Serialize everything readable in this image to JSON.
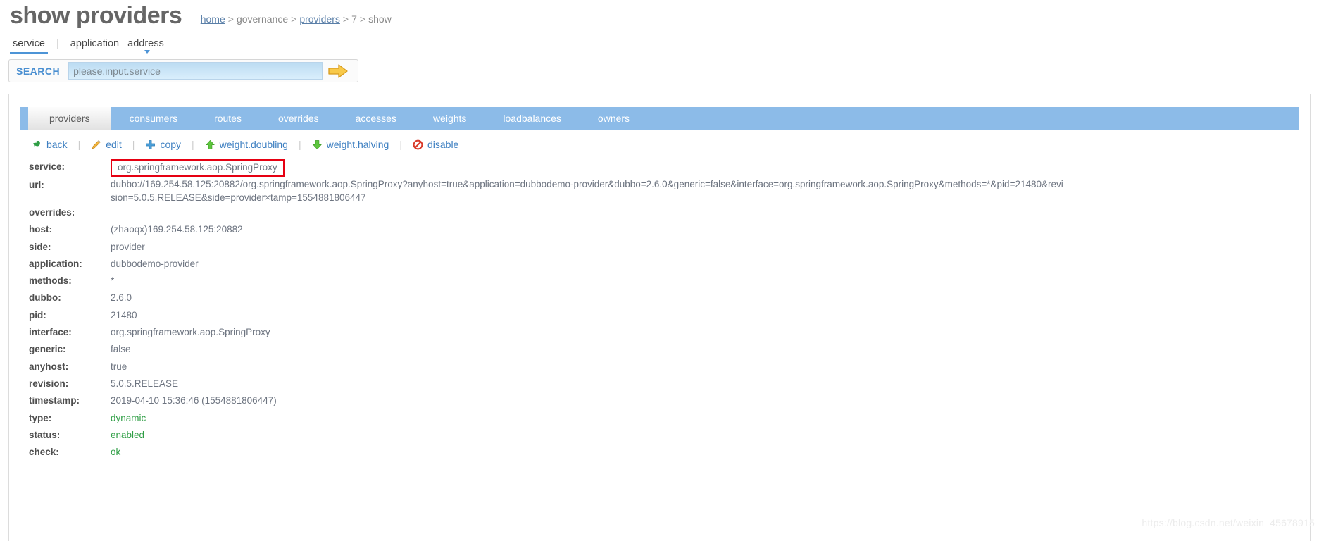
{
  "header": {
    "title": "show providers",
    "breadcrumb": [
      {
        "text": "home",
        "link": true
      },
      {
        "text": ">",
        "sep": true
      },
      {
        "text": "governance",
        "link": false
      },
      {
        "text": ">",
        "sep": true
      },
      {
        "text": "providers",
        "link": true
      },
      {
        "text": ">",
        "sep": true
      },
      {
        "text": "7",
        "link": false
      },
      {
        "text": ">",
        "sep": true
      },
      {
        "text": "show",
        "link": false
      }
    ],
    "breadcrumb_items": {
      "home": "home",
      "governance": "governance",
      "providers": "providers",
      "id": "7",
      "action": "show"
    }
  },
  "subnav": {
    "items": [
      {
        "label": "service",
        "active": true
      },
      {
        "label": "application",
        "active": false
      },
      {
        "label": "address",
        "active": false
      }
    ]
  },
  "search": {
    "label": "SEARCH",
    "placeholder": "please.input.service",
    "value": "",
    "submit_icon": "arrow-right-icon"
  },
  "tabs": [
    {
      "label": "providers",
      "active": true
    },
    {
      "label": "consumers",
      "active": false
    },
    {
      "label": "routes",
      "active": false
    },
    {
      "label": "overrides",
      "active": false
    },
    {
      "label": "accesses",
      "active": false
    },
    {
      "label": "weights",
      "active": false
    },
    {
      "label": "loadbalances",
      "active": false
    },
    {
      "label": "owners",
      "active": false
    }
  ],
  "toolbar": [
    {
      "label": "back",
      "icon": "back-arrow-icon",
      "color": "#2f9e45"
    },
    {
      "label": "edit",
      "icon": "pencil-icon",
      "color": "#e8a33d"
    },
    {
      "label": "copy",
      "icon": "plus-cross-icon",
      "color": "#4a9ed8"
    },
    {
      "label": "weight.doubling",
      "icon": "arrow-up-icon",
      "color": "#4fb83c"
    },
    {
      "label": "weight.halving",
      "icon": "arrow-down-icon",
      "color": "#4fb83c"
    },
    {
      "label": "disable",
      "icon": "no-entry-icon",
      "color": "#d93b2b"
    }
  ],
  "details": [
    {
      "key": "service:",
      "value": "org.springframework.aop.SpringProxy",
      "boxed": true,
      "style": "normal"
    },
    {
      "key": "url:",
      "value": "dubbo://169.254.58.125:20882/org.springframework.aop.SpringProxy?anyhost=true&application=dubbodemo-provider&dubbo=2.6.0&generic=false&interface=org.springframework.aop.SpringProxy&methods=*&pid=21480&revision=5.0.5.RELEASE&side=provider×tamp=1554881806447",
      "boxed": false,
      "style": "url"
    },
    {
      "key": "overrides:",
      "value": "",
      "boxed": false,
      "style": "normal"
    },
    {
      "key": "host:",
      "value": "(zhaoqx)169.254.58.125:20882",
      "boxed": false,
      "style": "normal"
    },
    {
      "key": "side:",
      "value": "provider",
      "boxed": false,
      "style": "normal"
    },
    {
      "key": "application:",
      "value": "dubbodemo-provider",
      "boxed": false,
      "style": "normal"
    },
    {
      "key": "methods:",
      "value": "*",
      "boxed": false,
      "style": "normal"
    },
    {
      "key": "dubbo:",
      "value": "2.6.0",
      "boxed": false,
      "style": "normal"
    },
    {
      "key": "pid:",
      "value": "21480",
      "boxed": false,
      "style": "normal"
    },
    {
      "key": "interface:",
      "value": "org.springframework.aop.SpringProxy",
      "boxed": false,
      "style": "normal"
    },
    {
      "key": "generic:",
      "value": "false",
      "boxed": false,
      "style": "normal"
    },
    {
      "key": "anyhost:",
      "value": "true",
      "boxed": false,
      "style": "normal"
    },
    {
      "key": "revision:",
      "value": "5.0.5.RELEASE",
      "boxed": false,
      "style": "normal"
    },
    {
      "key": "timestamp:",
      "value": "2019-04-10 15:36:46 (1554881806447)",
      "boxed": false,
      "style": "normal"
    },
    {
      "key": "type:",
      "value": "dynamic",
      "boxed": false,
      "style": "green"
    },
    {
      "key": "status:",
      "value": "enabled",
      "boxed": false,
      "style": "green"
    },
    {
      "key": "check:",
      "value": "ok",
      "boxed": false,
      "style": "green"
    }
  ],
  "watermark": "https://blog.csdn.net/weixin_45678915",
  "colors": {
    "tab_bar": "#8cbbe8",
    "link": "#3d7fc1",
    "highlight_box": "#e60012",
    "green_value": "#2f9e45",
    "title": "#666666"
  }
}
